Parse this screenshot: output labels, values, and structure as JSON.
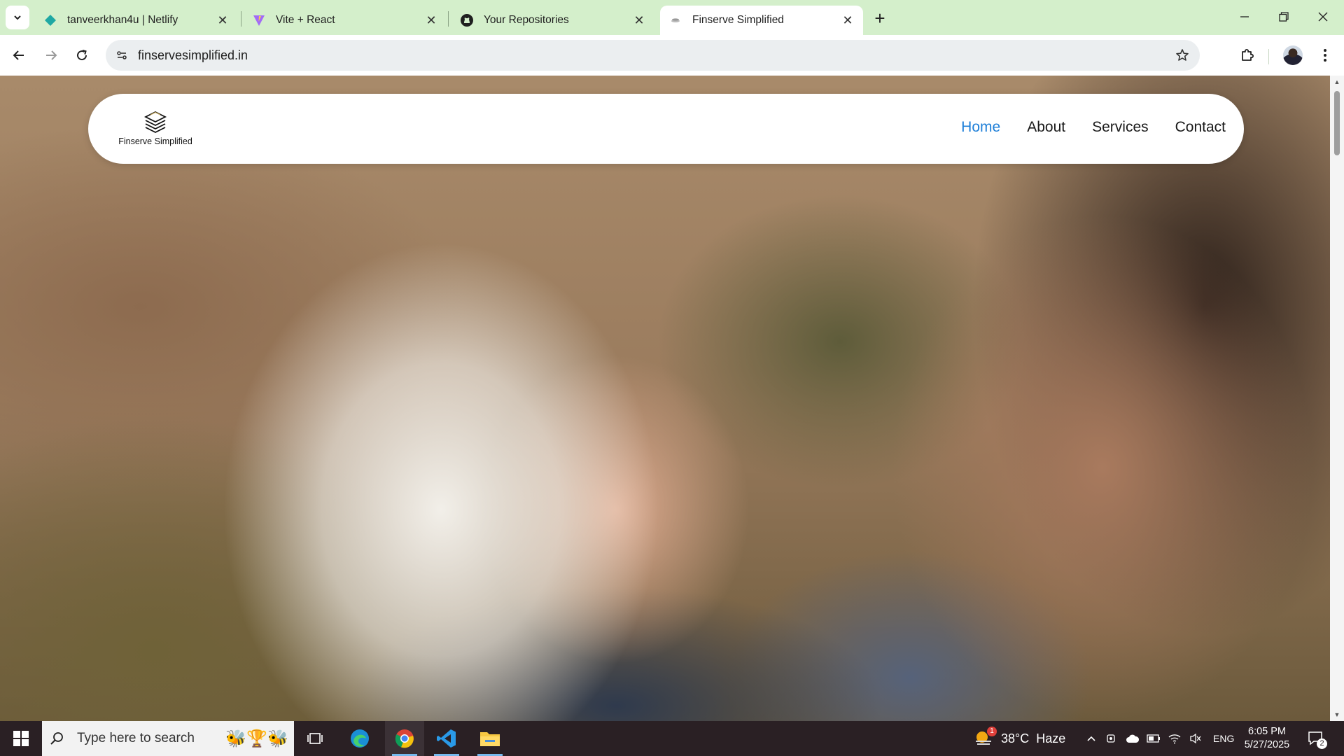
{
  "browser": {
    "tabs": [
      {
        "label": "tanveerkhan4u | Netlify",
        "icon": "netlify-icon",
        "active": false
      },
      {
        "label": "Vite + React",
        "icon": "vite-icon",
        "active": false
      },
      {
        "label": "Your Repositories",
        "icon": "github-icon",
        "active": false
      },
      {
        "label": "Finserve Simplified",
        "icon": "site-favicon",
        "active": true
      }
    ],
    "url": "finservesimplified.in"
  },
  "site": {
    "brand_name": "Finserve Simplified",
    "nav": [
      {
        "label": "Home",
        "active": true
      },
      {
        "label": "About",
        "active": false
      },
      {
        "label": "Services",
        "active": false
      },
      {
        "label": "Contact",
        "active": false
      }
    ],
    "accent_color": "#1e7fd8"
  },
  "taskbar": {
    "search_placeholder": "Type here to search",
    "weather_badge": "1",
    "weather": "38°C  Haze",
    "language": "ENG",
    "time": "6:05 PM",
    "date": "5/27/2025",
    "notification_count": "2"
  }
}
